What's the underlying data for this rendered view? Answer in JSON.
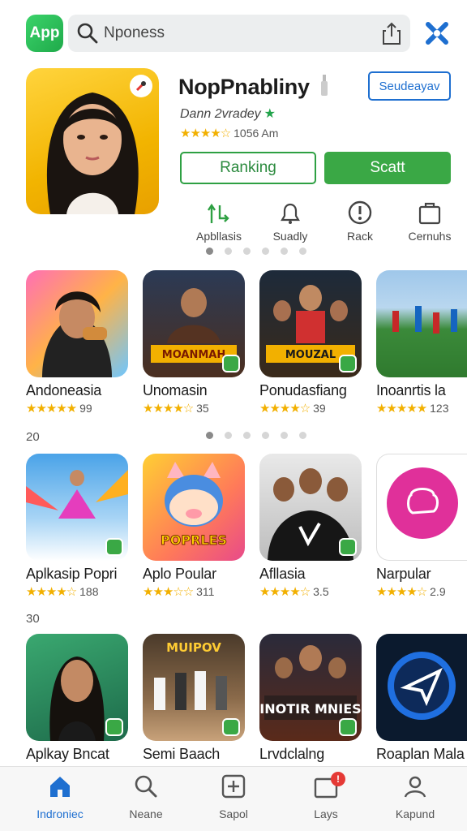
{
  "header": {
    "app_badge": "App",
    "search_text": "Nponess"
  },
  "hero": {
    "title": "NopPnabliny",
    "developer": "Dann 2vradey",
    "rating_stars": "★★★★☆",
    "rating_count": "1056 Am",
    "tag": "Seudeayav",
    "btn_ranking": "Ranking",
    "btn_primary": "Scatt",
    "quick_actions": [
      {
        "label": "Apbllasis",
        "icon": "chart-arrows-icon"
      },
      {
        "label": "Suadly",
        "icon": "bell-icon"
      },
      {
        "label": "Rack",
        "icon": "alert-icon"
      },
      {
        "label": "Cernuhs",
        "icon": "bag-icon"
      }
    ]
  },
  "rows": [
    {
      "label": "",
      "items": [
        {
          "name": "Andoneasia",
          "stars": "★★★★★",
          "rating": "99"
        },
        {
          "name": "Unomasin",
          "stars": "★★★★☆",
          "rating": "35"
        },
        {
          "name": "Ponudasfiang",
          "stars": "★★★★☆",
          "rating": "39"
        },
        {
          "name": "Inoanrtis la",
          "stars": "★★★★★",
          "rating": "123"
        }
      ]
    },
    {
      "label": "20",
      "items": [
        {
          "name": "Aplkasip Popri",
          "stars": "★★★★☆",
          "rating": "188"
        },
        {
          "name": "Aplo Poular",
          "stars": "★★★☆☆",
          "rating": "311"
        },
        {
          "name": "Afllasia",
          "stars": "★★★★☆",
          "rating": "3.5"
        },
        {
          "name": "Narpular",
          "stars": "★★★★☆",
          "rating": "2.9"
        }
      ]
    },
    {
      "label": "30",
      "items": [
        {
          "name": "Aplkay Bncat",
          "stars": "",
          "rating": ""
        },
        {
          "name": "Semi Baach",
          "stars": "",
          "rating": ""
        },
        {
          "name": "Lrvdclalng",
          "stars": "",
          "rating": ""
        },
        {
          "name": "Roaplan Mala",
          "stars": "",
          "rating": ""
        }
      ]
    }
  ],
  "tile_text": {
    "unomasin": "MOANMAH",
    "ponudasfiang": "MOUZAL",
    "aplo_poular": "POPRLES",
    "semi_baach_top": "MUIPOV",
    "lrvdclalng": "INOTIR MNIES"
  },
  "bottom_nav": [
    {
      "label": "Indroniec",
      "icon": "home-icon",
      "active": true
    },
    {
      "label": "Neane",
      "icon": "search-icon",
      "active": false
    },
    {
      "label": "Sapol",
      "icon": "add-box-icon",
      "active": false
    },
    {
      "label": "Lays",
      "icon": "inbox-icon",
      "active": false,
      "badge": "!"
    },
    {
      "label": "Kapund",
      "icon": "person-icon",
      "active": false
    }
  ],
  "colors": {
    "accent_green": "#3aa845",
    "accent_blue": "#1e6fd0",
    "star": "#f2b000"
  }
}
